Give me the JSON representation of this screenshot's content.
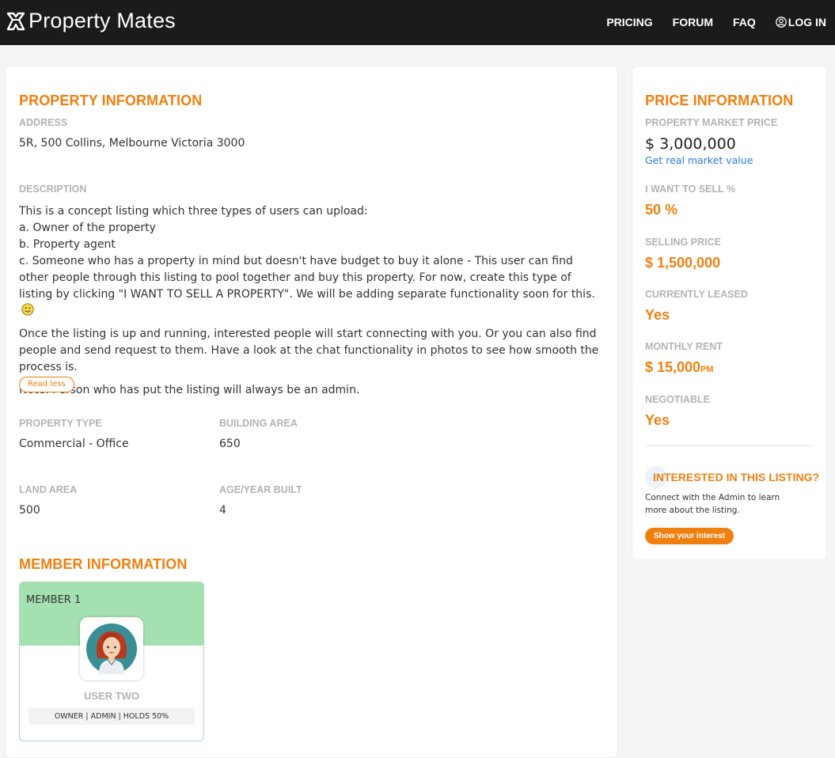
{
  "header": {
    "brand": "Property Mates",
    "nav": [
      {
        "label": "PRICING"
      },
      {
        "label": "FORUM"
      },
      {
        "label": "FAQ"
      },
      {
        "label": "LOG IN"
      }
    ]
  },
  "property": {
    "section_title": "PROPERTY INFORMATION",
    "address_label": "ADDRESS",
    "address": "5R, 500 Collins, Melbourne Victoria 3000",
    "description_label": "DESCRIPTION",
    "description": {
      "intro": "This is a concept listing which three types of users can upload:",
      "a": "a. Owner of the property",
      "b": "b. Property agent",
      "c": "c. Someone who has a property in mind but doesn't have budget to buy it alone - This user can find other people through this listing to pool together and buy this property. For now, create this type of listing by clicking \"I WANT TO SELL A PROPERTY\". We will be adding separate functionality soon for this.",
      "p2": "Once the listing is up and running, interested people will start connecting with you. Or you can also find people and send request to them. Have a look at the chat functionality in photos to see how smooth the process is.",
      "p3": "Note: Person who has put the listing will always be an admin."
    },
    "read_less": "Read less",
    "property_type_label": "PROPERTY TYPE",
    "property_type": "Commercial - Office",
    "building_area_label": "BUILDING AREA",
    "building_area": "650",
    "land_area_label": "LAND AREA",
    "land_area": "500",
    "age_label": "AGE/YEAR BUILT",
    "age": "4"
  },
  "members": {
    "section_title": "MEMBER INFORMATION",
    "items": [
      {
        "title": "MEMBER 1",
        "name": "USER TWO",
        "role": "OWNER | ADMIN | HOLDS 50%"
      }
    ]
  },
  "price": {
    "section_title": "PRICE INFORMATION",
    "market_label": "PROPERTY MARKET PRICE",
    "market_price": "$ 3,000,000",
    "market_link": "Get real market value",
    "sell_pct_label": "I WANT TO SELL %",
    "sell_pct": "50 %",
    "selling_price_label": "SELLING PRICE",
    "selling_price": "$ 1,500,000",
    "leased_label": "CURRENTLY LEASED",
    "leased": "Yes",
    "rent_label": "MONTHLY RENT",
    "rent": "$ 15,000",
    "rent_unit": "PM",
    "negotiable_label": "NEGOTIABLE",
    "negotiable": "Yes",
    "interest_title": "INTERESTED IN THIS LISTING?",
    "interest_text": "Connect with the Admin to learn more about the listing.",
    "interest_button": "Show your interest"
  },
  "colors": {
    "accent": "#f07f10",
    "topbar": "#1b1b1b",
    "link": "#2a7ad8",
    "member_header": "#a5e0b1"
  }
}
